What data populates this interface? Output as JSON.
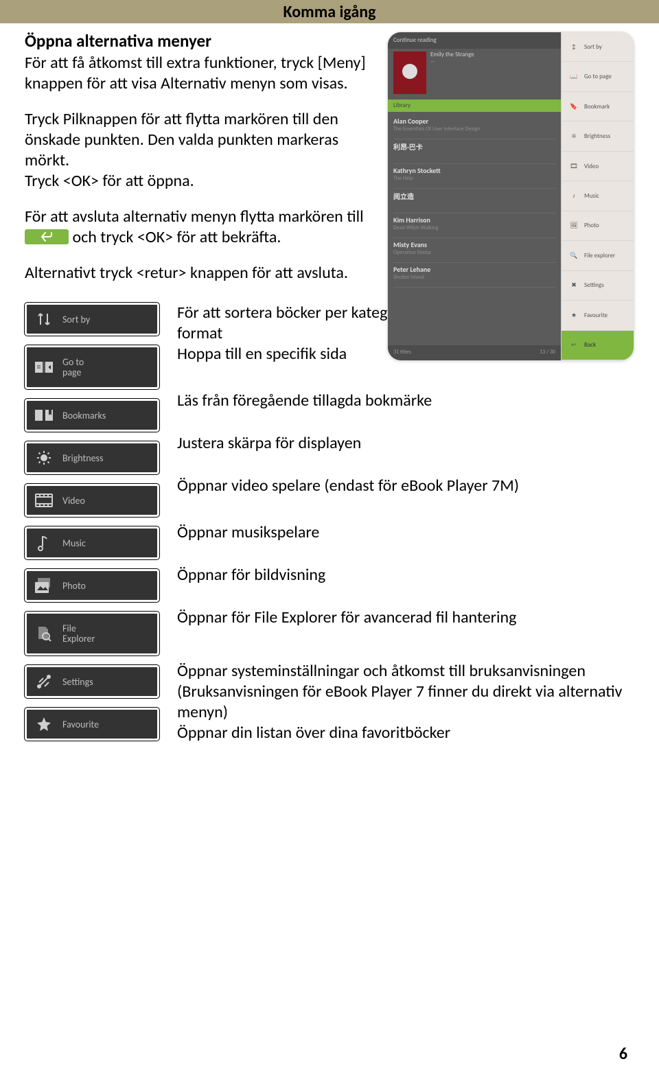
{
  "header": {
    "title": "Komma igång"
  },
  "section": {
    "title": "Öppna alternativa menyer",
    "p1": "För att få åtkomst till extra funktioner, tryck [Meny] knappen för att visa Alternativ menyn som visas.",
    "p2": "Tryck Pilknappen för att flytta markören till den önskade punkten. Den valda punkten markeras mörkt.",
    "p3": "Tryck <OK> för att öppna.",
    "p4a": "För att avsluta alternativ menyn flytta markören till ",
    "p4b": " och tryck <OK> för att bekräfta.",
    "p5": "Alternativt tryck <retur> knappen  för att avsluta."
  },
  "screenshot": {
    "continue_reading": "Continue reading",
    "library_bar": "Library",
    "rows": [
      {
        "a": "Alan Cooper",
        "b": "The Essentials Of User Interface Design"
      },
      {
        "a": "利昂·巴卡",
        "b": ""
      },
      {
        "a": "Kathryn Stockett",
        "b": "The Help"
      },
      {
        "a": "阅立造",
        "b": ""
      },
      {
        "a": "Kim Harrison",
        "b": "Dead Witch Walking"
      },
      {
        "a": "Misty Evans",
        "b": "Operation Sheba"
      },
      {
        "a": "Peter Lehane",
        "b": "Shutter Island"
      }
    ],
    "bottom_left": "31 titles",
    "bottom_right": "13 / 30",
    "menu": [
      "Sort by",
      "Go to page",
      "Bookmark",
      "Brightness",
      "Video",
      "Music",
      "Photo",
      "File explorer",
      "Settings",
      "Favourite",
      "Back"
    ]
  },
  "buttons": [
    {
      "icon": "sort",
      "label": "Sort by"
    },
    {
      "icon": "goto",
      "label": "Go to\npage",
      "multi": true,
      "tall": true
    },
    {
      "icon": "bookmark",
      "label": "Bookmarks"
    },
    {
      "icon": "brightness",
      "label": "Brightness"
    },
    {
      "icon": "video",
      "label": "Video"
    },
    {
      "icon": "music",
      "label": "Music"
    },
    {
      "icon": "photo",
      "label": "Photo"
    },
    {
      "icon": "file",
      "label": "File\nExplorer",
      "multi": true,
      "tall": true
    },
    {
      "icon": "settings",
      "label": "Settings"
    },
    {
      "icon": "favourite",
      "label": "Favourite"
    }
  ],
  "descriptions": [
    "För att sortera böcker per kategori: Titel, författare, kategori, datum, format",
    "Hoppa till en specifik sida",
    "Läs från föregående tillagda bokmärke",
    "Justera skärpa för displayen",
    "Öppnar video spelare (endast för eBook Player 7M)",
    "Öppnar musikspelare",
    "Öppnar för bildvisning",
    "Öppnar för File Explorer för avancerad fil hantering",
    "Öppnar systeminställningar och åtkomst till bruksanvisningen (Bruksanvisningen för eBook Player 7 finner du direkt via alternativ menyn)",
    "Öppnar din listan över dina favoritböcker"
  ],
  "page_number": "6"
}
